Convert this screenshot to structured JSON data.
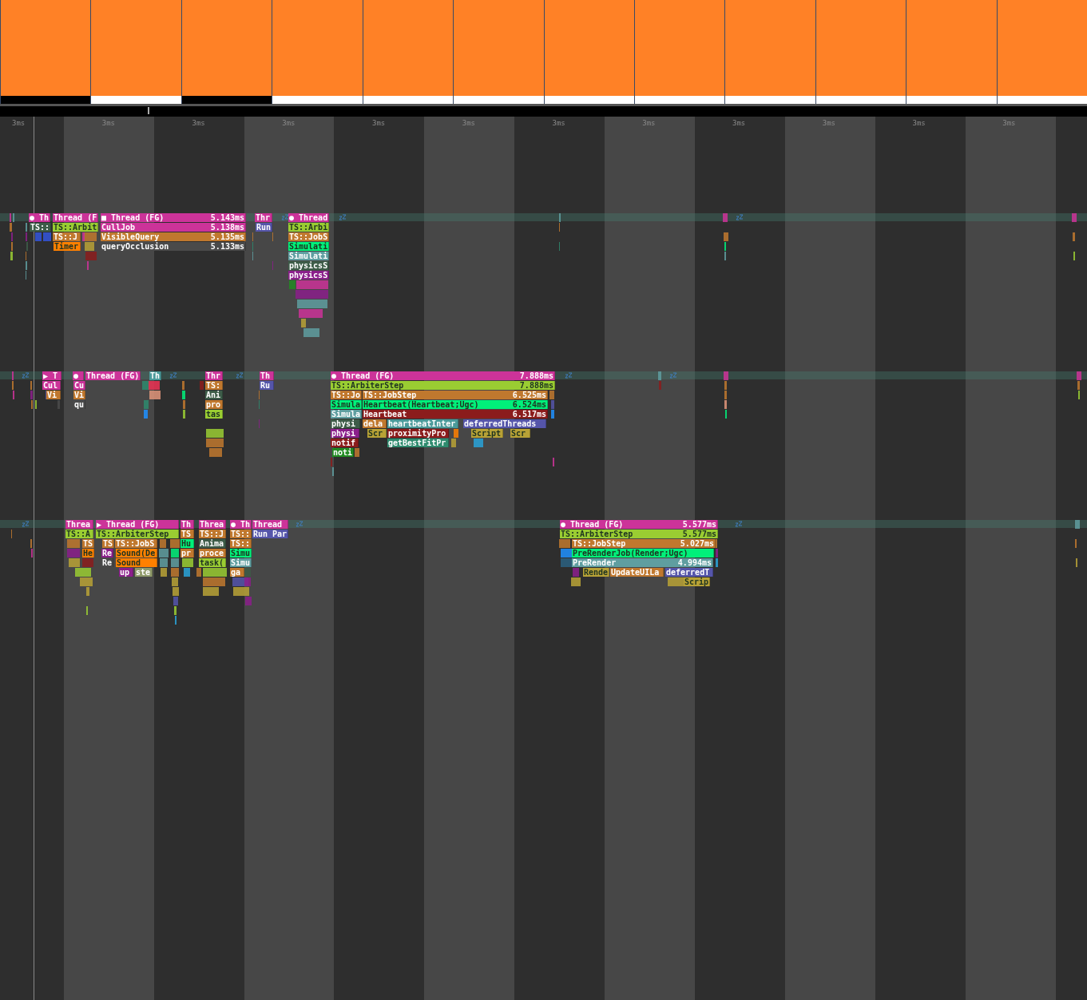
{
  "frames": [
    {
      "selected": true
    },
    {
      "selected": false
    },
    {
      "selected": true
    },
    {
      "selected": false
    },
    {
      "selected": false
    },
    {
      "selected": false
    },
    {
      "selected": false
    },
    {
      "selected": false
    },
    {
      "selected": false
    },
    {
      "selected": false
    },
    {
      "selected": false
    },
    {
      "selected": false
    }
  ],
  "ruler": {
    "ticks": [
      "3ms",
      "3ms",
      "3ms",
      "3ms",
      "3ms",
      "3ms",
      "3ms",
      "3ms",
      "3ms",
      "3ms",
      "3ms",
      "3ms"
    ]
  },
  "tracks": [
    {
      "blocks": [
        {
          "label": "● Th",
          "color": "#cc3399"
        },
        {
          "label": "Thread (F",
          "color": "#cc3399"
        },
        {
          "label": "■ Thread (FG)",
          "duration": "5.143ms",
          "color": "#cc3399"
        },
        {
          "label": "Thr",
          "color": "#cc3399"
        },
        {
          "label": "● Thread",
          "color": "#cc3399"
        },
        {
          "label": "TS::",
          "color": "#3d5c48"
        },
        {
          "label": "TS::Arbit",
          "color": "#9acd32"
        },
        {
          "label": "CullJob",
          "duration": "5.138ms",
          "color": "#cc3399"
        },
        {
          "label": "Run",
          "color": "#5555aa"
        },
        {
          "label": "TS::Arbi",
          "color": "#9acd32"
        },
        {
          "label": "TS::J",
          "color": "#c0782e"
        },
        {
          "label": "VisibleQuery",
          "duration": "5.135ms",
          "color": "#c0782e"
        },
        {
          "label": "TS::JobS",
          "color": "#c0782e"
        },
        {
          "label": "Timer",
          "color": "#ff8000"
        },
        {
          "label": "queryOcclusion",
          "duration": "5.133ms",
          "color": "#4a4a4a"
        },
        {
          "label": "Simulati",
          "color": "#00f07a"
        },
        {
          "label": "Simulati",
          "color": "#5f9ea0"
        },
        {
          "label": "physicsS",
          "color": "#3d5c48"
        },
        {
          "label": "physicsS",
          "color": "#8b1f8b"
        }
      ]
    },
    {
      "blocks": [
        {
          "label": "▶ T",
          "color": "#cc3399"
        },
        {
          "label": "●",
          "color": "#cc3399"
        },
        {
          "label": "Thread (FG)",
          "color": "#cc3399"
        },
        {
          "label": "Th",
          "color": "#4a9a9a"
        },
        {
          "label": "Thr",
          "color": "#cc3399"
        },
        {
          "label": "Th",
          "color": "#cc3399"
        },
        {
          "label": "● Thread (FG)",
          "duration": "7.888ms",
          "color": "#cc3399"
        },
        {
          "label": "Cul",
          "color": "#cc3399"
        },
        {
          "label": "Cu",
          "color": "#cc3399"
        },
        {
          "label": "TS:",
          "color": "#c0782e"
        },
        {
          "label": "Ru",
          "color": "#5555aa"
        },
        {
          "label": "TS::ArbiterStep",
          "duration": "7.888ms",
          "color": "#9acd32"
        },
        {
          "label": "Vi",
          "color": "#c0782e"
        },
        {
          "label": "Vi",
          "color": "#c0782e"
        },
        {
          "label": "Ani",
          "color": "#3d5c48"
        },
        {
          "label": "TS::Jo",
          "color": "#c0782e"
        },
        {
          "label": "TS::JobStep",
          "duration": "6.525ms",
          "color": "#c0782e"
        },
        {
          "label": "qu",
          "color": "#4a4a4a"
        },
        {
          "label": "pro",
          "color": "#c0782e"
        },
        {
          "label": "Simula",
          "color": "#00f07a"
        },
        {
          "label": "Heartbeat(Heartbeat;Ugc)",
          "duration": "6.524ms",
          "color": "#00f07a"
        },
        {
          "label": "tas",
          "color": "#9acd32"
        },
        {
          "label": "Simula",
          "color": "#5f9ea0"
        },
        {
          "label": "Heartbeat",
          "duration": "6.517ms",
          "color": "#8b1c1c"
        },
        {
          "label": "physi",
          "color": "#3d5c48"
        },
        {
          "label": "dela",
          "color": "#c0782e"
        },
        {
          "label": "heartbeatInter",
          "color": "#4a9a9a"
        },
        {
          "label": "deferredThreads",
          "color": "#5555aa"
        },
        {
          "label": "physi",
          "color": "#8b1f8b"
        },
        {
          "label": "Scr",
          "color": "#b8a236"
        },
        {
          "label": "proximityPro",
          "color": "#8b1c1c"
        },
        {
          "label": "Script",
          "color": "#b8a236"
        },
        {
          "label": "Scr",
          "color": "#b8a236"
        },
        {
          "label": "notif",
          "color": "#8b1c1c"
        },
        {
          "label": "getBestFitPr",
          "color": "#2e8b6e"
        },
        {
          "label": "noti",
          "color": "#228b22"
        }
      ]
    },
    {
      "blocks": [
        {
          "label": "Threa",
          "color": "#cc3399"
        },
        {
          "label": "▶ Thread (FG)",
          "color": "#cc3399"
        },
        {
          "label": "Th",
          "color": "#cc3399"
        },
        {
          "label": "Threa",
          "color": "#cc3399"
        },
        {
          "label": "● Th",
          "color": "#cc3399"
        },
        {
          "label": "Thread",
          "color": "#cc3399"
        },
        {
          "label": "● Thread (FG)",
          "duration": "5.577ms",
          "color": "#cc3399"
        },
        {
          "label": "TS::A",
          "color": "#9acd32"
        },
        {
          "label": "TS::ArbiterStep",
          "color": "#9acd32"
        },
        {
          "label": "TS",
          "color": "#c0782e"
        },
        {
          "label": "TS::J",
          "color": "#c0782e"
        },
        {
          "label": "TS::",
          "color": "#c0782e"
        },
        {
          "label": "Run Par",
          "color": "#5555aa"
        },
        {
          "label": "TS::ArbiterStep",
          "duration": "5.577ms",
          "color": "#9acd32"
        },
        {
          "label": "TS",
          "color": "#c0782e"
        },
        {
          "label": "TS",
          "color": "#c0782e"
        },
        {
          "label": "TS::JobS",
          "color": "#c0782e"
        },
        {
          "label": "Hu",
          "color": "#00f07a"
        },
        {
          "label": "Anima",
          "color": "#3d5c48"
        },
        {
          "label": "TS::",
          "color": "#c0782e"
        },
        {
          "label": "TS::JobStep",
          "duration": "5.027ms",
          "color": "#c0782e"
        },
        {
          "label": "He",
          "color": "#ff8000"
        },
        {
          "label": "Re",
          "color": "#8b1f8b"
        },
        {
          "label": "Sound(De",
          "color": "#ff8000"
        },
        {
          "label": "pr",
          "color": "#c0782e"
        },
        {
          "label": "proce",
          "color": "#c0782e"
        },
        {
          "label": "Simu",
          "color": "#00f07a"
        },
        {
          "label": "PreRenderJob(Render;Ugc)",
          "color": "#00f07a"
        },
        {
          "label": "Re",
          "color": "#4a4a4a"
        },
        {
          "label": "Sound",
          "color": "#ff8000"
        },
        {
          "label": "task(",
          "color": "#9acd32"
        },
        {
          "label": "Simu",
          "color": "#5f9ea0"
        },
        {
          "label": "PreRender",
          "duration": "4.994ms",
          "color": "#5f9ea0"
        },
        {
          "label": "up",
          "color": "#8b1f8b"
        },
        {
          "label": "ste",
          "color": "#8f9a6a"
        },
        {
          "label": "ga",
          "color": "#c0782e"
        },
        {
          "label": "Rende",
          "color": "#b8a236"
        },
        {
          "label": "UpdateUILa",
          "color": "#c0782e"
        },
        {
          "label": "deferredT",
          "color": "#5555aa"
        },
        {
          "label": "Scrip",
          "color": "#b8a236"
        }
      ]
    }
  ]
}
